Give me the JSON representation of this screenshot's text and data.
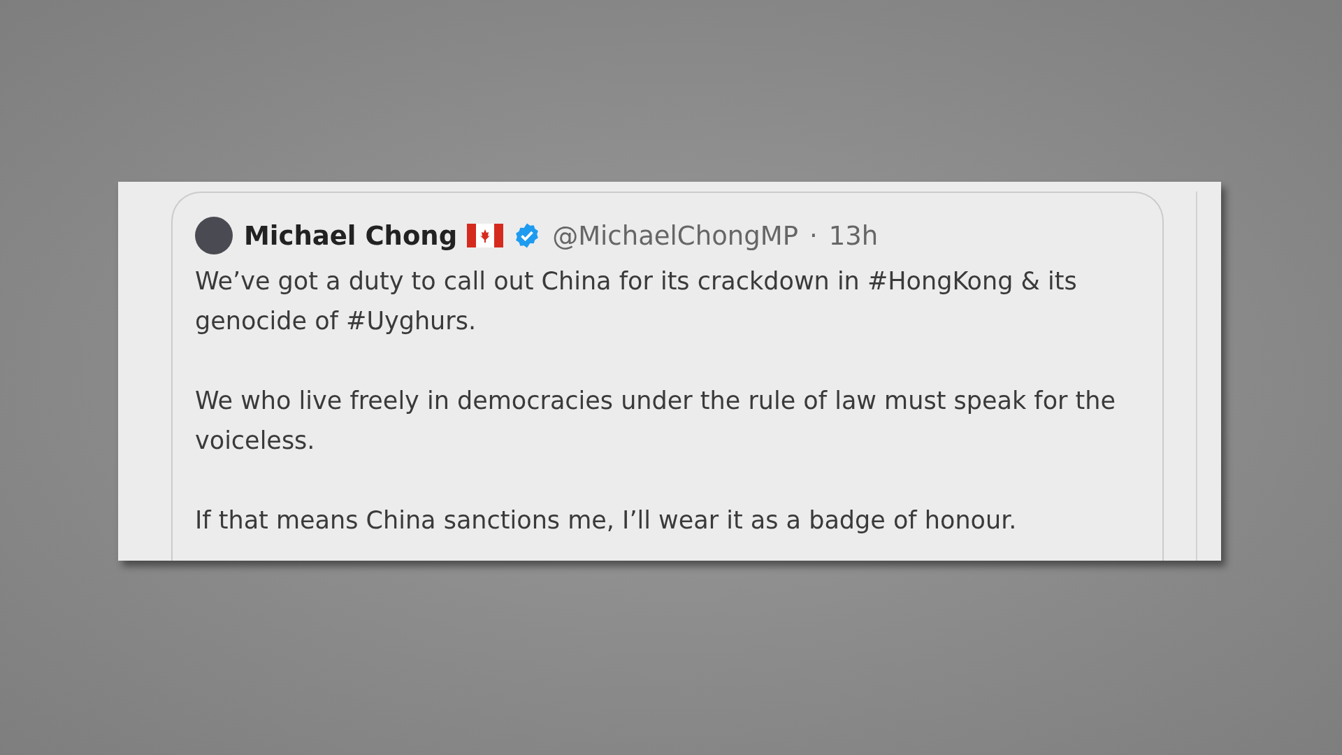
{
  "tweet": {
    "name": "Michael Chong",
    "handle": "@MichaelChongMP",
    "separator": "·",
    "time": "13h",
    "verified": true,
    "paragraphs": [
      "We’ve got a duty to call out China for its crackdown in #HongKong & its genocide of #Uyghurs.",
      "We who live freely in democracies under the rule of law must speak for the voiceless.",
      "If that means China sanctions me, I’ll wear it as a badge of honour."
    ]
  }
}
